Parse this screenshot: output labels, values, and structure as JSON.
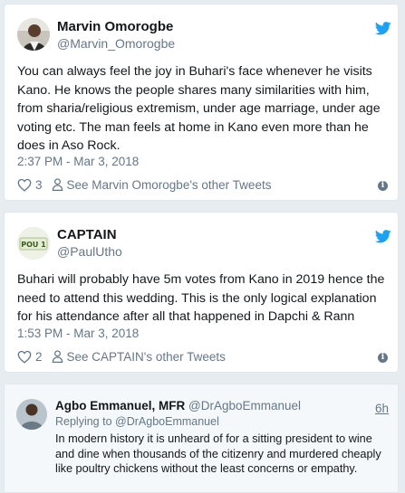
{
  "tweets": [
    {
      "name": "Marvin Omorogbe",
      "handle": "@Marvin_Omorogbe",
      "text": "You can always feel the joy in Buhari's face whenever he visits Kano. He knows the people shares many similarities with him, from sharia/religious extremism, under age marriage, under age voting etc. The man feels at home in Kano even more than he does in Aso Rock.",
      "time": "2:37 PM - Mar 3, 2018",
      "likes": "3",
      "other_tweets": "See Marvin Omorogbe's other Tweets"
    },
    {
      "name": "CAPTAIN",
      "handle": "@PaulUtho",
      "text": "Buhari will probably have 5m votes from Kano in 2019 hence the need to attend this wedding. This is the only logical explanation for his attendance after all that happened in Dapchi & Rann",
      "time": "1:53 PM - Mar 3, 2018",
      "likes": "2",
      "other_tweets": "See CAPTAIN's other Tweets",
      "avatar_text": "POU 1"
    }
  ],
  "reply": {
    "name": "Agbo Emmanuel, MFR",
    "handle": "@DrAgboEmmanuel",
    "time": "6h",
    "replying_prefix": "Replying to",
    "replying_to": "@DrAgboEmmanuel",
    "text": "In modern history it is unheard of for a sitting president to wine and dine when thousands of the citizenry and murdered cheaply like poultry chickens without the least concerns or empathy."
  },
  "colors": {
    "twitter_blue": "#1da1f2",
    "secondary_text": "#657786",
    "background": "#e6ecf0"
  }
}
